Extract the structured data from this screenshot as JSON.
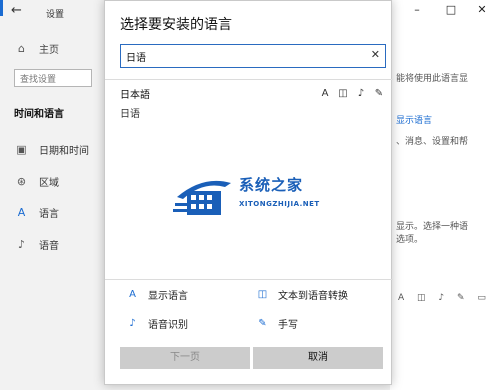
{
  "settings": {
    "title": "设置",
    "back_icon": "back-arrow-icon",
    "home_label": "主页",
    "search_placeholder": "查找设置",
    "section_title": "时间和语言",
    "nav_items": [
      {
        "label": "日期和时间",
        "icon": "calendar-clock-icon"
      },
      {
        "label": "区域",
        "icon": "globe-icon"
      },
      {
        "label": "语言",
        "icon": "language-icon"
      },
      {
        "label": "语音",
        "icon": "microphone-icon"
      }
    ],
    "right_text_1": "能将使用此语言显",
    "right_link_1": "显示语言",
    "right_text_2": "、消息、设置和帮",
    "right_text_3": "显示。选择一种语",
    "right_text_4": "选项。"
  },
  "dialog": {
    "title": "选择要安装的语言",
    "search_value": "日语",
    "language": {
      "native_name": "日本語",
      "local_name": "日语",
      "capability_icons": [
        "display-language-icon",
        "text-to-speech-icon",
        "speech-recognition-icon",
        "handwriting-icon"
      ]
    },
    "features": [
      {
        "label": "显示语言",
        "icon": "display-language-icon"
      },
      {
        "label": "文本到语音转换",
        "icon": "text-to-speech-icon"
      },
      {
        "label": "语音识别",
        "icon": "speech-recognition-icon"
      },
      {
        "label": "手写",
        "icon": "handwriting-icon"
      }
    ],
    "next_button": "下一页",
    "cancel_button": "取消"
  },
  "watermark": {
    "main": "系统之家",
    "sub": "XITONGZHIJIA.NET"
  },
  "colors": {
    "accent": "#1a6bd1",
    "watermark": "#1a5fb8",
    "button_bg": "#cccccc"
  }
}
